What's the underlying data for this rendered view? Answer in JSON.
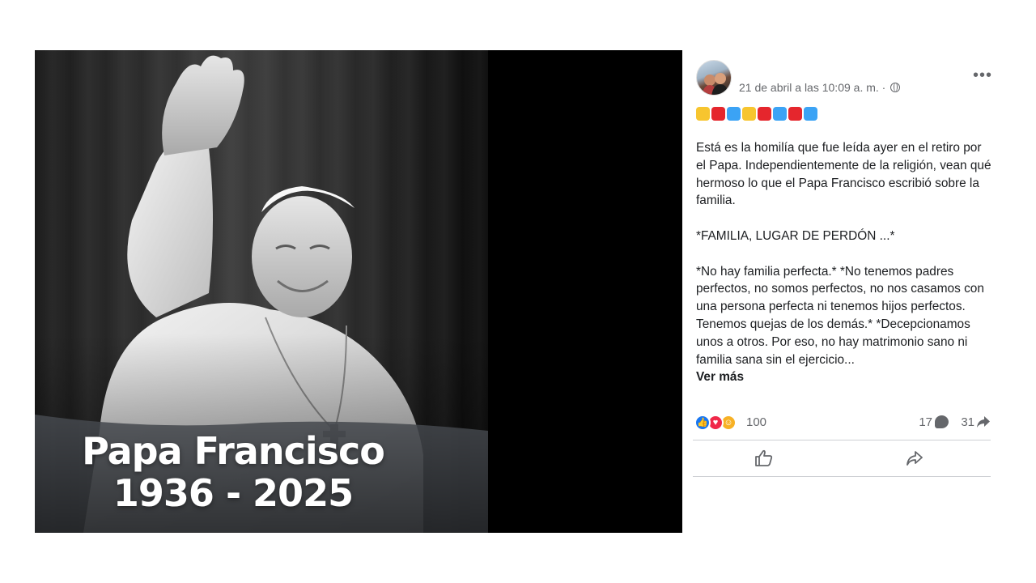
{
  "media": {
    "title_line1": "Papa Francisco",
    "title_line2": "1936 - 2025"
  },
  "post": {
    "timestamp": "21 de abril a las 10:09 a. m. ·",
    "emoji_colors": [
      "#f7c52f",
      "#e5262d",
      "#3ba3f5",
      "#f7c52f",
      "#e5262d",
      "#3ba3f5",
      "#e5262d",
      "#3ba3f5"
    ],
    "paragraph1": "Está es la homilía que fue leída ayer en el retiro por el Papa. Independientemente de la religión, vean qué hermoso lo que el Papa Francisco escribió sobre la familia.",
    "paragraph2": "*FAMILIA, LUGAR DE PERDÓN ...*",
    "paragraph3": "*No hay familia perfecta.* *No tenemos padres perfectos, no somos perfectos, no nos casamos con una persona perfecta ni tenemos hijos perfectos. Tenemos quejas de los demás.* *Decepcionamos unos a otros. Por eso, no hay matrimonio sano ni familia sana sin el ejercicio...",
    "see_more": "Ver más"
  },
  "reactions": {
    "count": "100",
    "comments": "17",
    "shares": "31",
    "like_color": "#1877f2",
    "love_color": "#f02849",
    "care_color": "#f7b125"
  }
}
